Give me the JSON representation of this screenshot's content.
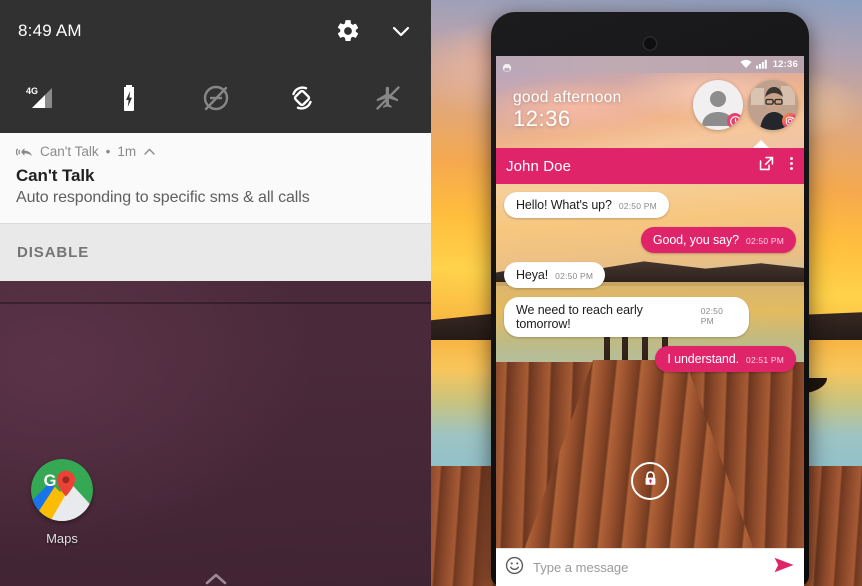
{
  "left_panel": {
    "quick_settings": {
      "clock": "8:49 AM",
      "settings_icon": "gear-icon",
      "collapse_icon": "chevron-down-icon",
      "tiles": [
        {
          "name": "mobile-data",
          "label": "4G",
          "icon": "signal-bar-icon",
          "active": true
        },
        {
          "name": "battery",
          "label": "",
          "icon": "battery-charging-icon",
          "active": true
        },
        {
          "name": "do-not-disturb",
          "label": "",
          "icon": "do-not-disturb-off-icon",
          "active": false
        },
        {
          "name": "auto-rotate",
          "label": "",
          "icon": "screen-rotation-icon",
          "active": true
        },
        {
          "name": "airplane-mode",
          "label": "",
          "icon": "airplane-off-icon",
          "active": false
        }
      ]
    },
    "notification": {
      "app_icon": "reply-broadcast-icon",
      "app_name": "Can't Talk",
      "separator": "•",
      "time_ago": "1m",
      "expand_icon": "chevron-up-icon",
      "title": "Can't Talk",
      "body": "Auto responding to specific sms & all calls",
      "action_label": "DISABLE"
    },
    "home_screen": {
      "app": {
        "icon": "google-maps-icon",
        "label": "Maps"
      },
      "drawer_icon": "chevron-up-icon"
    }
  },
  "right_panel": {
    "device": {
      "earpiece_icon": "earpiece-icon"
    },
    "status_bar": {
      "left_icon": "android-robot-icon",
      "wifi_icon": "wifi-icon",
      "signal_icon": "signal-bars-icon",
      "time": "12:36"
    },
    "greeting": {
      "salutation": "good afternoon",
      "time": "12:36",
      "avatars": [
        {
          "name": "contact-placeholder-avatar",
          "icon": "person-icon",
          "badge": "clock-badge-icon"
        },
        {
          "name": "contact-photo-avatar",
          "icon": "photo-avatar",
          "badge": "instagram-badge-icon"
        }
      ]
    },
    "app_bar": {
      "title": "John Doe",
      "open_external_icon": "open-in-new-icon",
      "overflow_icon": "more-vert-icon"
    },
    "messages": [
      {
        "dir": "in",
        "text": "Hello! What's up?",
        "time": "02:50 PM"
      },
      {
        "dir": "out",
        "text": "Good, you say?",
        "time": "02:50 PM"
      },
      {
        "dir": "in",
        "text": "Heya!",
        "time": "02:50 PM"
      },
      {
        "dir": "in",
        "text": "We need to reach early tomorrow!",
        "time": "02:50 PM"
      },
      {
        "dir": "out",
        "text": "I understand.",
        "time": "02:51 PM"
      }
    ],
    "lock_button": {
      "icon": "lock-icon"
    },
    "composer": {
      "emoji_icon": "emoji-smile-icon",
      "value": "",
      "placeholder": "Type a message",
      "send_icon": "send-icon"
    }
  },
  "colors": {
    "accent_pink": "#e0246a",
    "shade_dark": "#313131",
    "notification_bg": "#fafafa",
    "action_bg": "#e9e9e9"
  }
}
